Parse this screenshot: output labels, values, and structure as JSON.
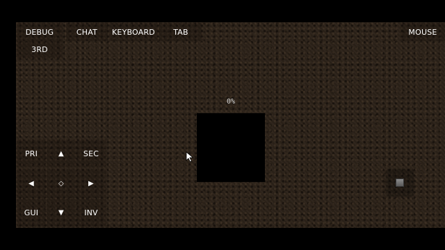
{
  "top_bar": {
    "debug": "DEBUG",
    "chat": "CHAT",
    "keyboard": "KEYBOARD",
    "tab": "TAB",
    "mouse": "MOUSE",
    "third_person": "3RD"
  },
  "loading": {
    "percent_text": "0%"
  },
  "dpad": {
    "primary": "PRI",
    "secondary": "SEC",
    "gui": "GUI",
    "inventory": "INV",
    "up": "▲",
    "down": "▼",
    "left": "◀",
    "right": "▶",
    "center": "◇"
  },
  "colors": {
    "background": "#2b2118",
    "text": "#ffffff",
    "loading_box": "#000000"
  },
  "icons": {
    "cursor": "mouse-pointer-icon",
    "hotbar": "hotbar-item-icon"
  }
}
